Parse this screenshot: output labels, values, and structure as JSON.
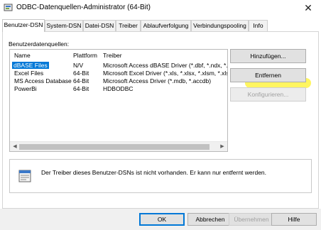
{
  "window": {
    "title": "ODBC-Datenquellen-Administrator (64-Bit)",
    "close_glyph": "✕"
  },
  "tabs": [
    {
      "label": "Benutzer-DSN",
      "active": true
    },
    {
      "label": "System-DSN"
    },
    {
      "label": "Datei-DSN"
    },
    {
      "label": "Treiber"
    },
    {
      "label": "Ablaufverfolgung"
    },
    {
      "label": "Verbindungspooling"
    },
    {
      "label": "Info"
    }
  ],
  "user_dsn": {
    "group_label": "Benutzerdatenquellen:",
    "columns": [
      "Name",
      "Plattform",
      "Treiber"
    ],
    "rows": [
      {
        "name": "dBASE Files",
        "platform": "N/V",
        "driver": "Microsoft Access dBASE Driver (*.dbf, *.ndx, *.m",
        "selected": true
      },
      {
        "name": "Excel Files",
        "platform": "64-Bit",
        "driver": "Microsoft Excel Driver (*.xls, *.xlsx, *.xlsm, *.xlsb)"
      },
      {
        "name": "MS Access Database",
        "platform": "64-Bit",
        "driver": "Microsoft Access Driver (*.mdb, *.accdb)"
      },
      {
        "name": "PowerBi",
        "platform": "64-Bit",
        "driver": "HDBODBC"
      }
    ],
    "buttons": {
      "add": "Hinzufügen...",
      "remove": "Entfernen",
      "configure": "Konfigurieren..."
    },
    "info_text": "Der Treiber dieses Benutzer-DSNs ist nicht vorhanden. Er kann nur entfernt werden."
  },
  "footer": {
    "ok": "OK",
    "cancel": "Abbrechen",
    "apply": "Übernehmen",
    "help": "Hilfe"
  },
  "colors": {
    "selection": "#0078d7",
    "highlight_marker": "#fff44f"
  }
}
